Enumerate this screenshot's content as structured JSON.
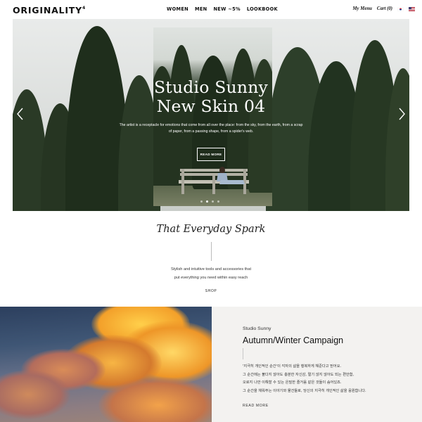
{
  "header": {
    "logo": "ORIGINALITY",
    "logo_sup": "4",
    "nav": [
      "WOMEN",
      "MEN",
      "NEW ~5%",
      "LOOKBOOK"
    ],
    "my_menu": "My Menu",
    "cart": "Cart (0)",
    "flags": [
      "korea-flag-icon",
      "usa-flag-icon"
    ]
  },
  "hero": {
    "title_line1": "Studio Sunny",
    "title_line2": "New Skin 04",
    "subtitle": "The artist is a receptacle for emotions that come from all over the place: from the sky, from the earth, from a scrap of paper, from a passing shape, from a spider's web.",
    "button": "READ MORE",
    "slide_count": 4,
    "active_slide": 1
  },
  "spark": {
    "title": "That Everyday Spark",
    "text_line1": "Stylish and intuitive tools and accessories that",
    "text_line2": "put everything you need within easy reach",
    "shop": "SHOP"
  },
  "campaign": {
    "label": "Studio Sunny",
    "title": "Autumn/Winter Campaign",
    "body": [
      "'지극히 개인적인 순간'이 각자의 삶을 행복하게 해준다고 믿어요.",
      "그 순간에는 불다지 않아도 충분한 자신감, 멀기 않지 않아도 되는 편안함,",
      "오로지 나만 이해할 수 있는 은밀한 즐거움 같은 것들이 숨어있죠.",
      "그 순간을 채워주는 이야기와 물건들로, 당신의 지극히 개인적인 삶을 응원합니다."
    ],
    "more": "READ MORE"
  }
}
